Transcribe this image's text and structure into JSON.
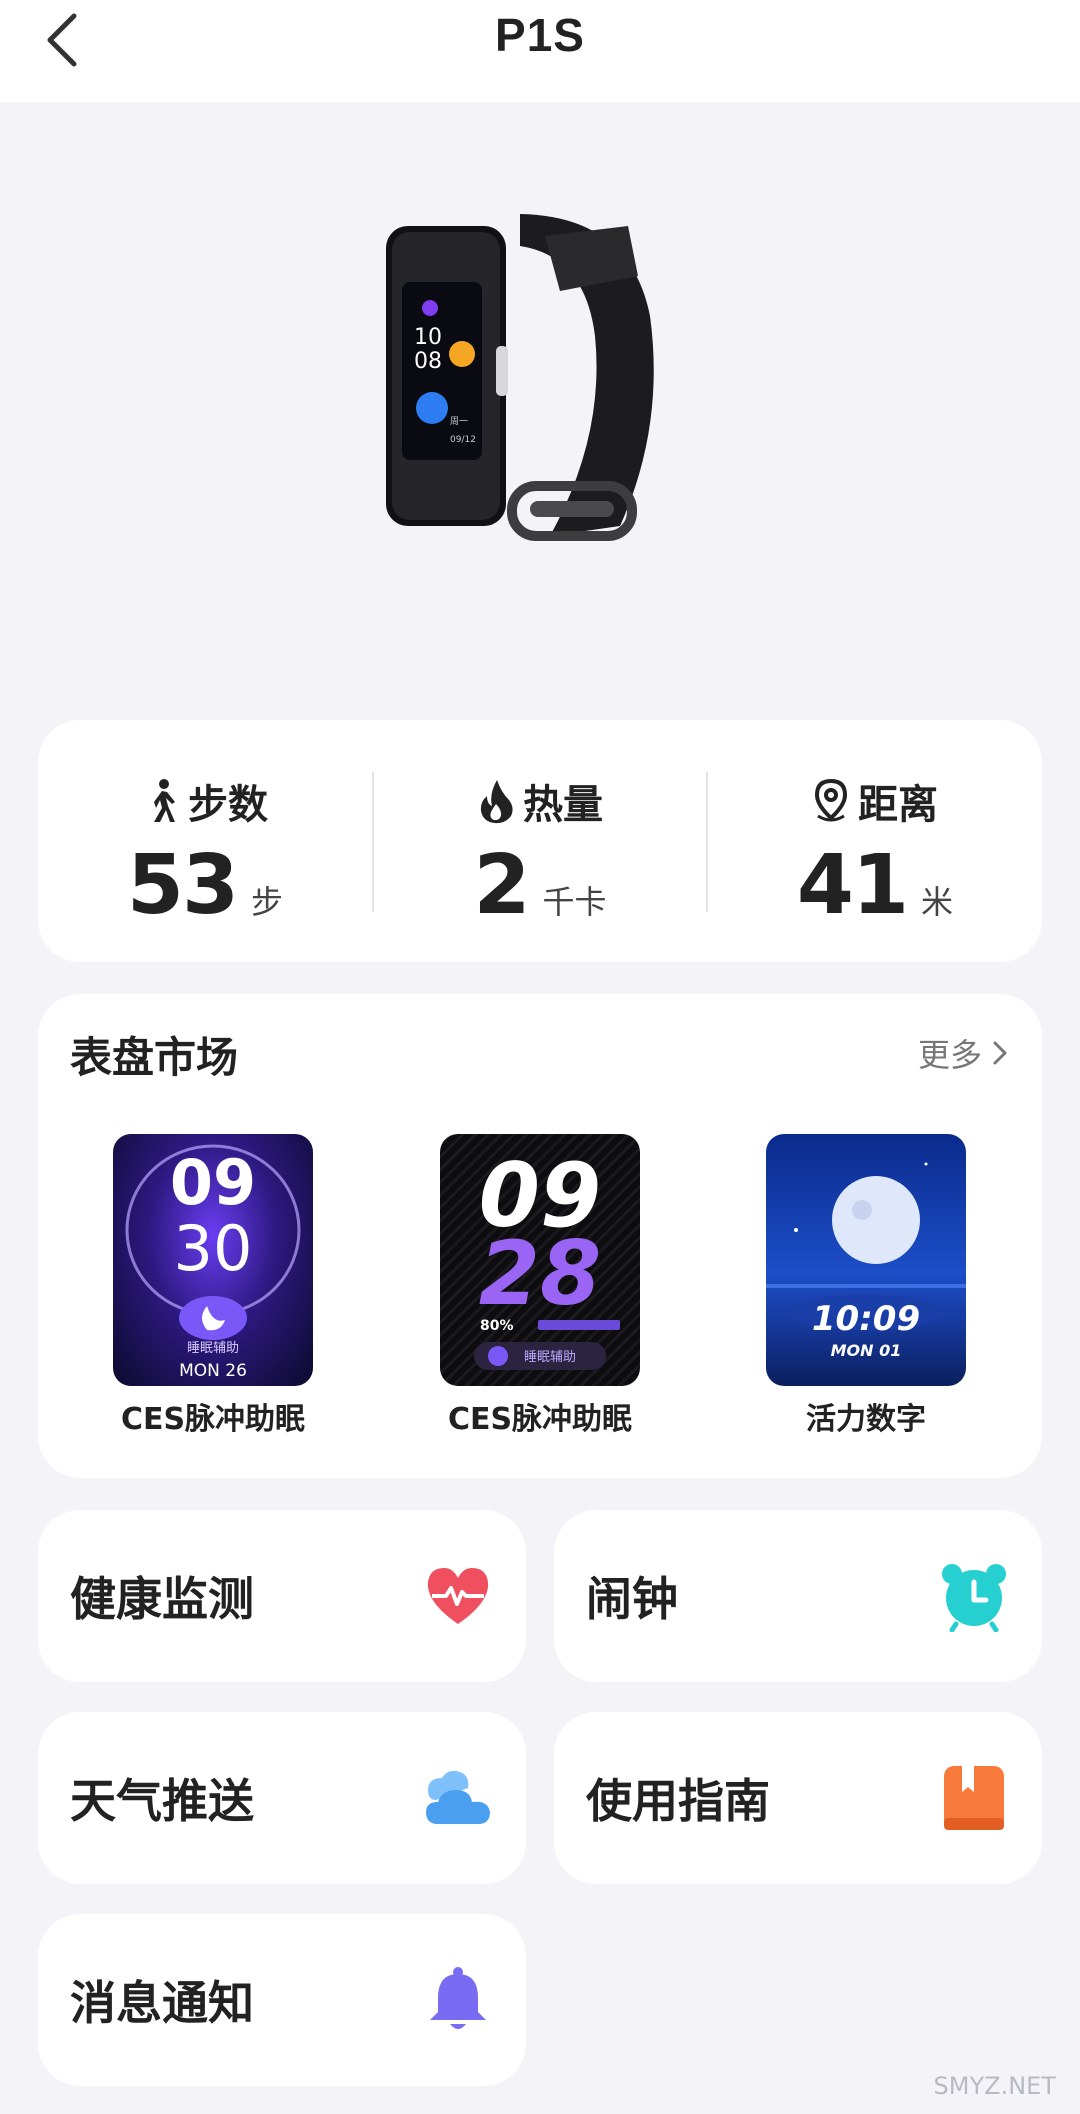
{
  "header": {
    "title": "P1S"
  },
  "stats": [
    {
      "label": "步数",
      "value": "53",
      "unit": "步",
      "icon": "walking-person-icon"
    },
    {
      "label": "热量",
      "value": "2",
      "unit": "千卡",
      "icon": "flame-icon"
    },
    {
      "label": "距离",
      "value": "41",
      "unit": "米",
      "icon": "location-pin-icon"
    }
  ],
  "market": {
    "title": "表盘市场",
    "more": "更多",
    "faces": [
      {
        "name": "CES脉冲助眠",
        "time_top": "09",
        "time_bottom": "30",
        "sub": "睡眠辅助",
        "date": "MON 26"
      },
      {
        "name": "CES脉冲助眠",
        "time_top": "09",
        "time_bottom": "28",
        "battery": "80%",
        "sub": "睡眠辅助"
      },
      {
        "name": "活力数字",
        "time": "10:09",
        "date": "MON 01"
      }
    ]
  },
  "functions": [
    {
      "label": "健康监测",
      "icon": "heart-pulse-icon"
    },
    {
      "label": "闹钟",
      "icon": "alarm-clock-icon"
    },
    {
      "label": "天气推送",
      "icon": "cloud-icon"
    },
    {
      "label": "使用指南",
      "icon": "guide-book-icon"
    },
    {
      "label": "消息通知",
      "icon": "bell-icon"
    }
  ],
  "device_screen": {
    "hour": "10",
    "minute": "08",
    "weekday": "周一",
    "date": "09/12"
  },
  "watermark": "SMYZ.NET",
  "colors": {
    "background": "#f3f3f8",
    "card": "#ffffff",
    "heart": "#ef4f5f",
    "alarm": "#27d0d0",
    "cloud": "#4a9ff0",
    "guide": "#f77a3a",
    "bell": "#7a6cf2"
  }
}
